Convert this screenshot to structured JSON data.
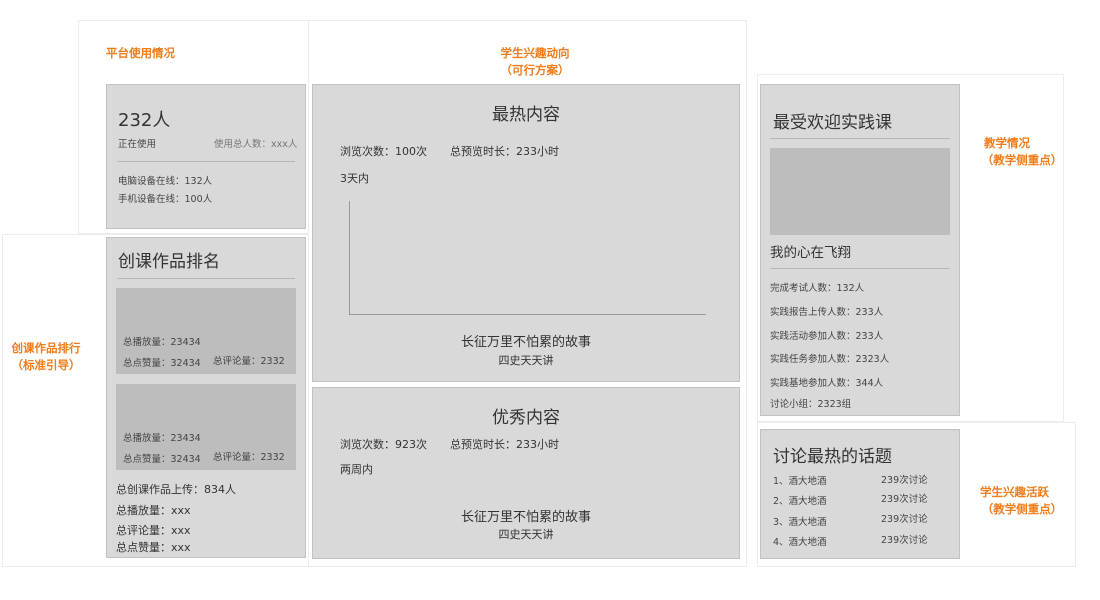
{
  "labels": {
    "platform": "平台使用情况",
    "interest_title": "学生兴趣动向",
    "interest_sub": "（可行方案）",
    "teaching_title": "教学情况",
    "teaching_sub": "（教学侧重点）",
    "ranking_title": "创课作品排行",
    "ranking_sub": "（标准引导）",
    "activity_title": "学生兴趣活跃",
    "activity_sub": "（教学侧重点）"
  },
  "usage": {
    "count": "232人",
    "status": "正在使用",
    "total": "使用总人数：xxx人",
    "pc_online": "电脑设备在线：132人",
    "mobile_online": "手机设备在线：100人"
  },
  "ranking": {
    "title": "创课作品排名",
    "cards": [
      {
        "plays": "总播放量：23434",
        "likes": "总点赞量：32434",
        "comments": "总评论量：2332"
      },
      {
        "plays": "总播放量：23434",
        "likes": "总点赞量：32434",
        "comments": "总评论量：2332"
      }
    ],
    "summary": {
      "uploads": "总创课作品上传：834人",
      "plays": "总播放量：xxx",
      "comments": "总评论量：xxx",
      "likes": "总点赞量：xxx"
    }
  },
  "hot": {
    "title": "最热内容",
    "views": "浏览次数：100次",
    "duration": "总预览时长：233小时",
    "period": "3天内",
    "story_title": "长征万里不怕累的故事",
    "story_sub": "四史天天讲"
  },
  "excellent": {
    "title": "优秀内容",
    "views": "浏览次数：923次",
    "duration": "总预览时长：233小时",
    "period": "两周内",
    "story_title": "长征万里不怕累的故事",
    "story_sub": "四史天天讲"
  },
  "practice": {
    "title": "最受欢迎实践课",
    "course_name": "我的心在飞翔",
    "stats": [
      "完成考试人数：132人",
      "实践报告上传人数：233人",
      "实践活动参加人数：233人",
      "实践任务参加人数：2323人",
      "实践基地参加人数：344人",
      "讨论小组：2323组"
    ]
  },
  "topics": {
    "title": "讨论最热的话题",
    "items": [
      {
        "name": "1、酒大地酒",
        "count": "239次讨论"
      },
      {
        "name": "2、酒大地酒",
        "count": "239次讨论"
      },
      {
        "name": "3、酒大地酒",
        "count": "239次讨论"
      },
      {
        "name": "4、酒大地酒",
        "count": "239次讨论"
      }
    ]
  },
  "colors": {
    "accent": "#f07c1a",
    "panel": "#d9d9d9",
    "thumb": "#bdbdbd"
  }
}
